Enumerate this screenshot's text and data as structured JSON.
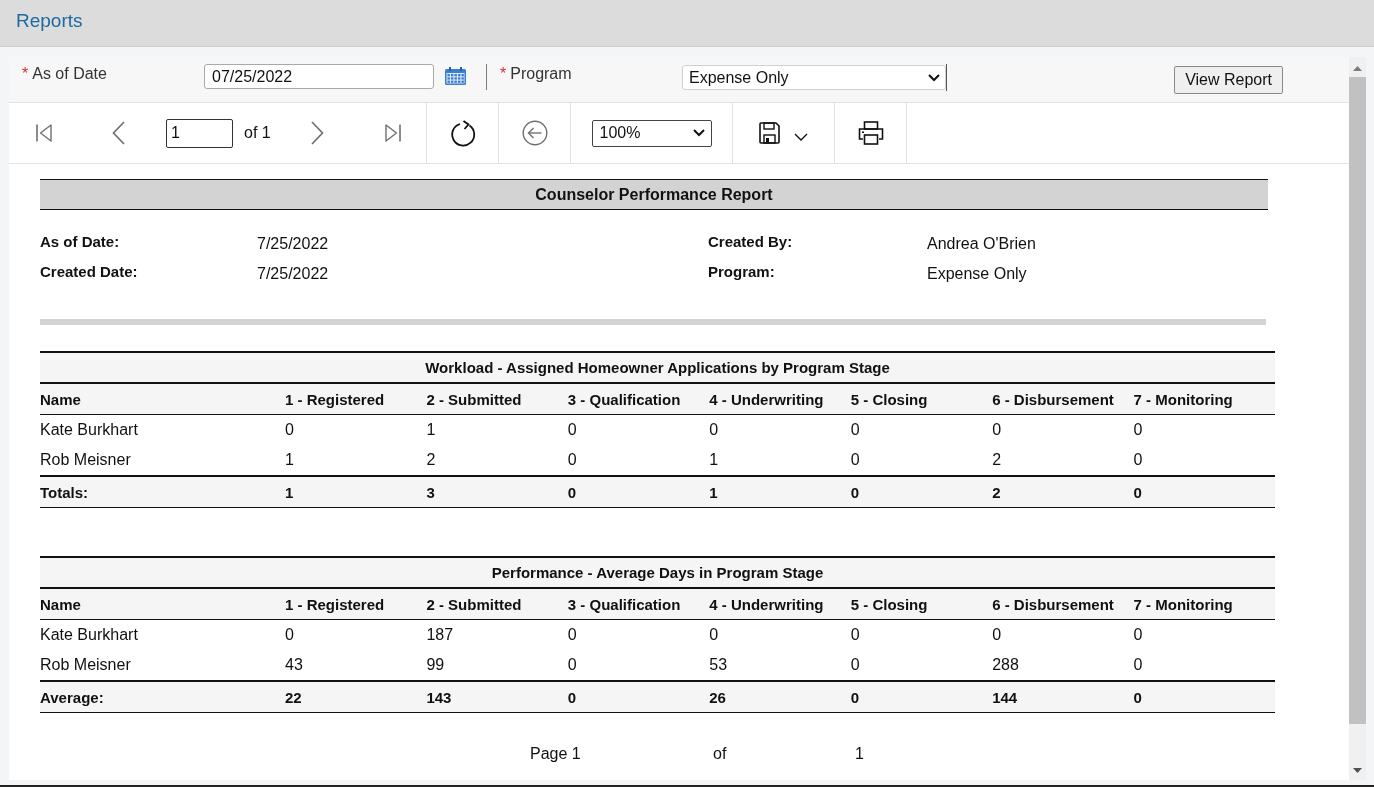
{
  "header": {
    "title": "Reports"
  },
  "parameters": {
    "fields": [
      {
        "kind": "date",
        "marker": "*",
        "label": "As of Date",
        "value": "07/25/2022"
      },
      {
        "kind": "select",
        "marker": "*",
        "label": "Program",
        "value": "Expense Only"
      }
    ],
    "view_button": "View Report"
  },
  "toolbar": {
    "groups": [
      {
        "items": [
          {
            "kind": "first",
            "disabled": true
          },
          {
            "kind": "previous",
            "disabled": true
          },
          {
            "kind": "page",
            "value": "1",
            "total": "of 1"
          },
          {
            "kind": "next",
            "disabled": true
          },
          {
            "kind": "last",
            "disabled": true
          }
        ]
      },
      {
        "items": [
          {
            "kind": "refresh",
            "disabled": false
          }
        ]
      },
      {
        "items": [
          {
            "kind": "back",
            "disabled": true
          }
        ]
      },
      {
        "items": [
          {
            "kind": "zoom",
            "value": "100%"
          }
        ]
      },
      {
        "items": [
          {
            "kind": "save",
            "disabled": false
          }
        ]
      },
      {
        "items": [
          {
            "kind": "print",
            "disabled": false
          }
        ]
      }
    ]
  },
  "report": {
    "title": "Counselor Performance Report",
    "details": [
      {
        "label": "As of Date:",
        "value": "7/25/2022"
      },
      {
        "label": "Created By:",
        "value": "Andrea O'Brien"
      },
      {
        "label": "Created Date:",
        "value": "7/25/2022"
      },
      {
        "label": "Program:",
        "value": "Expense Only"
      }
    ],
    "tables": [
      {
        "title": "Workload - Assigned Homeowner Applications by Program Stage",
        "columns": [
          "Name",
          "1 - Registered",
          "2 - Submitted",
          "3 - Qualification",
          "4 - Underwriting",
          "5 - Closing",
          "6 - Disbursement",
          "7 - Monitoring"
        ],
        "rows": [
          [
            "Kate Burkhart",
            "0",
            "1",
            "0",
            "0",
            "0",
            "0",
            "0"
          ],
          [
            "Rob Meisner",
            "1",
            "2",
            "0",
            "1",
            "0",
            "2",
            "0"
          ]
        ],
        "summary": [
          "Totals:",
          "1",
          "3",
          "0",
          "1",
          "0",
          "2",
          "0"
        ]
      },
      {
        "title": "Performance - Average Days in Program Stage",
        "columns": [
          "Name",
          "1 - Registered",
          "2 - Submitted",
          "3 - Qualification",
          "4 - Underwriting",
          "5 - Closing",
          "6 - Disbursement",
          "7 - Monitoring"
        ],
        "rows": [
          [
            "Kate Burkhart",
            "0",
            "187",
            "0",
            "0",
            "0",
            "0",
            "0"
          ],
          [
            "Rob Meisner",
            "43",
            "99",
            "0",
            "53",
            "0",
            "288",
            "0"
          ]
        ],
        "summary": [
          "Average:",
          "22",
          "143",
          "0",
          "26",
          "0",
          "144",
          "0"
        ]
      }
    ],
    "footer": {
      "page": "Page 1",
      "of": "of",
      "total": "1"
    }
  }
}
